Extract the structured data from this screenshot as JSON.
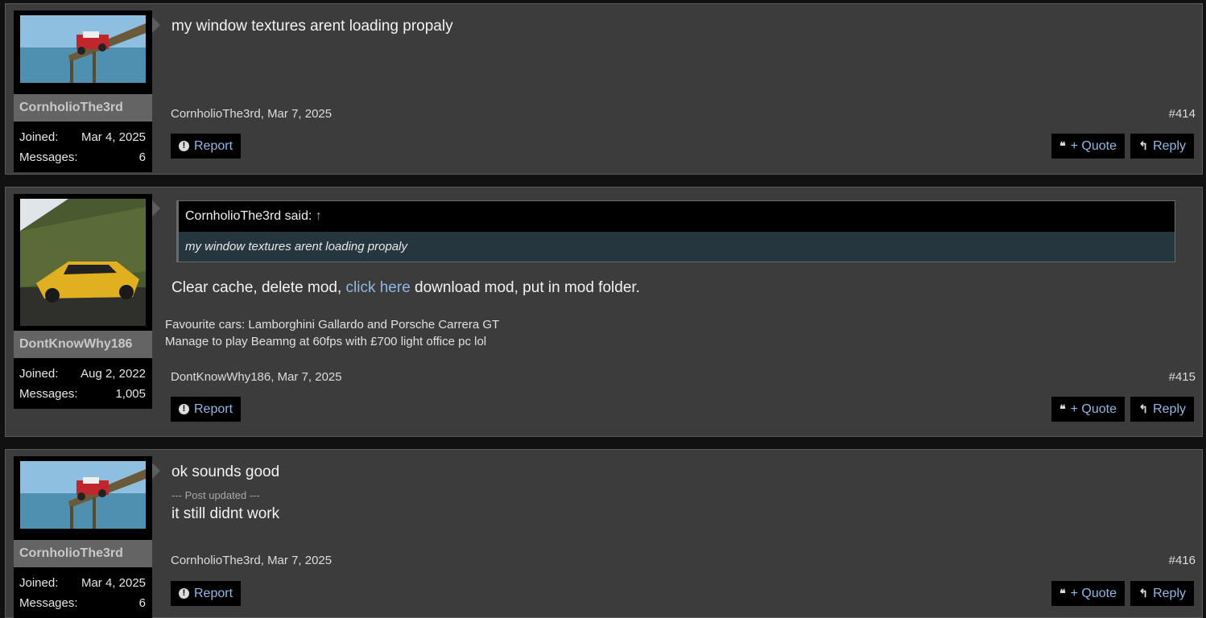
{
  "icons": {
    "report": "!",
    "quote": "❝",
    "reply": "↰"
  },
  "posts": [
    {
      "username": "CornholioThe3rd",
      "joined_label": "Joined:",
      "joined": "Mar 4, 2025",
      "messages_label": "Messages:",
      "messages": "6",
      "message": "my window textures arent loading propaly",
      "meta": "CornholioThe3rd, Mar 7, 2025",
      "number": "#414",
      "report": "Report",
      "quote": "+ Quote",
      "reply": "Reply"
    },
    {
      "username": "DontKnowWhy186",
      "joined_label": "Joined:",
      "joined": "Aug 2, 2022",
      "messages_label": "Messages:",
      "messages": "1,005",
      "quote_author": "CornholioThe3rd said:",
      "quote_arrow": "↑",
      "quote_text": "my window textures arent loading propaly",
      "msg_part1": "Clear cache, delete mod, ",
      "msg_link": "click here",
      "msg_part2": " download mod, put in mod folder.",
      "sig_line1": "Favourite cars: Lamborghini Gallardo and Porsche Carrera GT",
      "sig_line2": "Manage to play Beamng at 60fps with £700 light office pc lol",
      "meta": "DontKnowWhy186, Mar 7, 2025",
      "number": "#415",
      "report": "Report",
      "quote": "+ Quote",
      "reply": "Reply"
    },
    {
      "username": "CornholioThe3rd",
      "joined_label": "Joined:",
      "joined": "Mar 4, 2025",
      "messages_label": "Messages:",
      "messages": "6",
      "message": "ok sounds good",
      "updated": "--- Post updated ---",
      "message2": "it still didnt work",
      "meta": "CornholioThe3rd, Mar 7, 2025",
      "number": "#416",
      "report": "Report",
      "quote": "+ Quote",
      "reply": "Reply"
    }
  ]
}
